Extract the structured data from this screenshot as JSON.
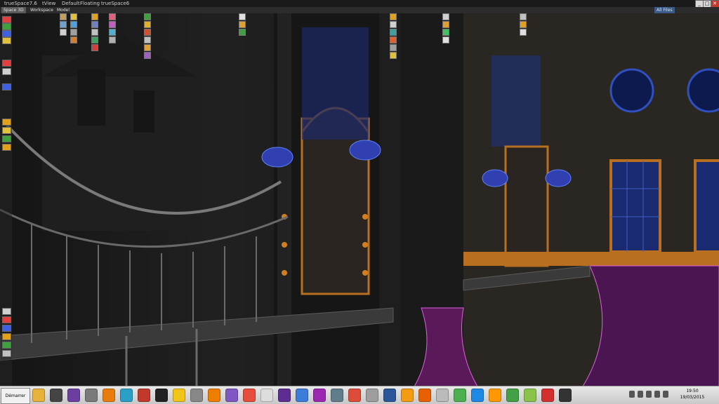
{
  "window": {
    "title": "trueSpace7.6",
    "menu_items": [
      "tView",
      "Default",
      "Floating",
      "trueSpace6"
    ],
    "controls": {
      "minimize": "_",
      "maximize": "□",
      "close": "✕"
    }
  },
  "tabs": [
    {
      "label": "Space 3D"
    },
    {
      "label": "Workspace"
    },
    {
      "label": "Model"
    }
  ],
  "right_labels": [
    "All Files"
  ],
  "taskbar": {
    "start_label": "Démarrer",
    "clock_time": "19:50",
    "clock_date": "19/03/2015",
    "apps": [
      {
        "name": "explorer-icon",
        "color": "#e6b23a"
      },
      {
        "name": "media-icon",
        "color": "#444"
      },
      {
        "name": "truespace-icon",
        "color": "#6b3fa0"
      },
      {
        "name": "network-icon",
        "color": "#7a7a7a"
      },
      {
        "name": "blender-icon",
        "color": "#e87d0d"
      },
      {
        "name": "gear-icon",
        "color": "#2aa0c8"
      },
      {
        "name": "acrobat-icon",
        "color": "#c0392b"
      },
      {
        "name": "circle-icon",
        "color": "#222"
      },
      {
        "name": "bulb-icon",
        "color": "#f0c419"
      },
      {
        "name": "cube-icon",
        "color": "#888"
      },
      {
        "name": "illustrator-icon",
        "color": "#ef7d00"
      },
      {
        "name": "folder-icon",
        "color": "#7e57c2"
      },
      {
        "name": "paint-icon",
        "color": "#e74c3c"
      },
      {
        "name": "blank-icon",
        "color": "#ddd"
      },
      {
        "name": "ps-icon",
        "color": "#5e2d91"
      },
      {
        "name": "globe-icon",
        "color": "#3b7dd8"
      },
      {
        "name": "ftp-icon",
        "color": "#9c27b0"
      },
      {
        "name": "grid-icon",
        "color": "#607d8b"
      },
      {
        "name": "chrome-icon",
        "color": "#dd4b39"
      },
      {
        "name": "box-icon",
        "color": "#9e9e9e"
      },
      {
        "name": "word-icon",
        "color": "#2b579a"
      },
      {
        "name": "orange-icon",
        "color": "#f39c12"
      },
      {
        "name": "firefox-icon",
        "color": "#e66000"
      },
      {
        "name": "shapes-icon",
        "color": "#bbb"
      },
      {
        "name": "earth-icon",
        "color": "#4caf50"
      },
      {
        "name": "ie-icon",
        "color": "#1e88e5"
      },
      {
        "name": "ball-icon",
        "color": "#ff9800"
      },
      {
        "name": "plant-icon",
        "color": "#43a047"
      },
      {
        "name": "frog-icon",
        "color": "#8bc34a"
      },
      {
        "name": "pdf-icon",
        "color": "#d32f2f"
      },
      {
        "name": "logo-icon",
        "color": "#333"
      }
    ]
  }
}
